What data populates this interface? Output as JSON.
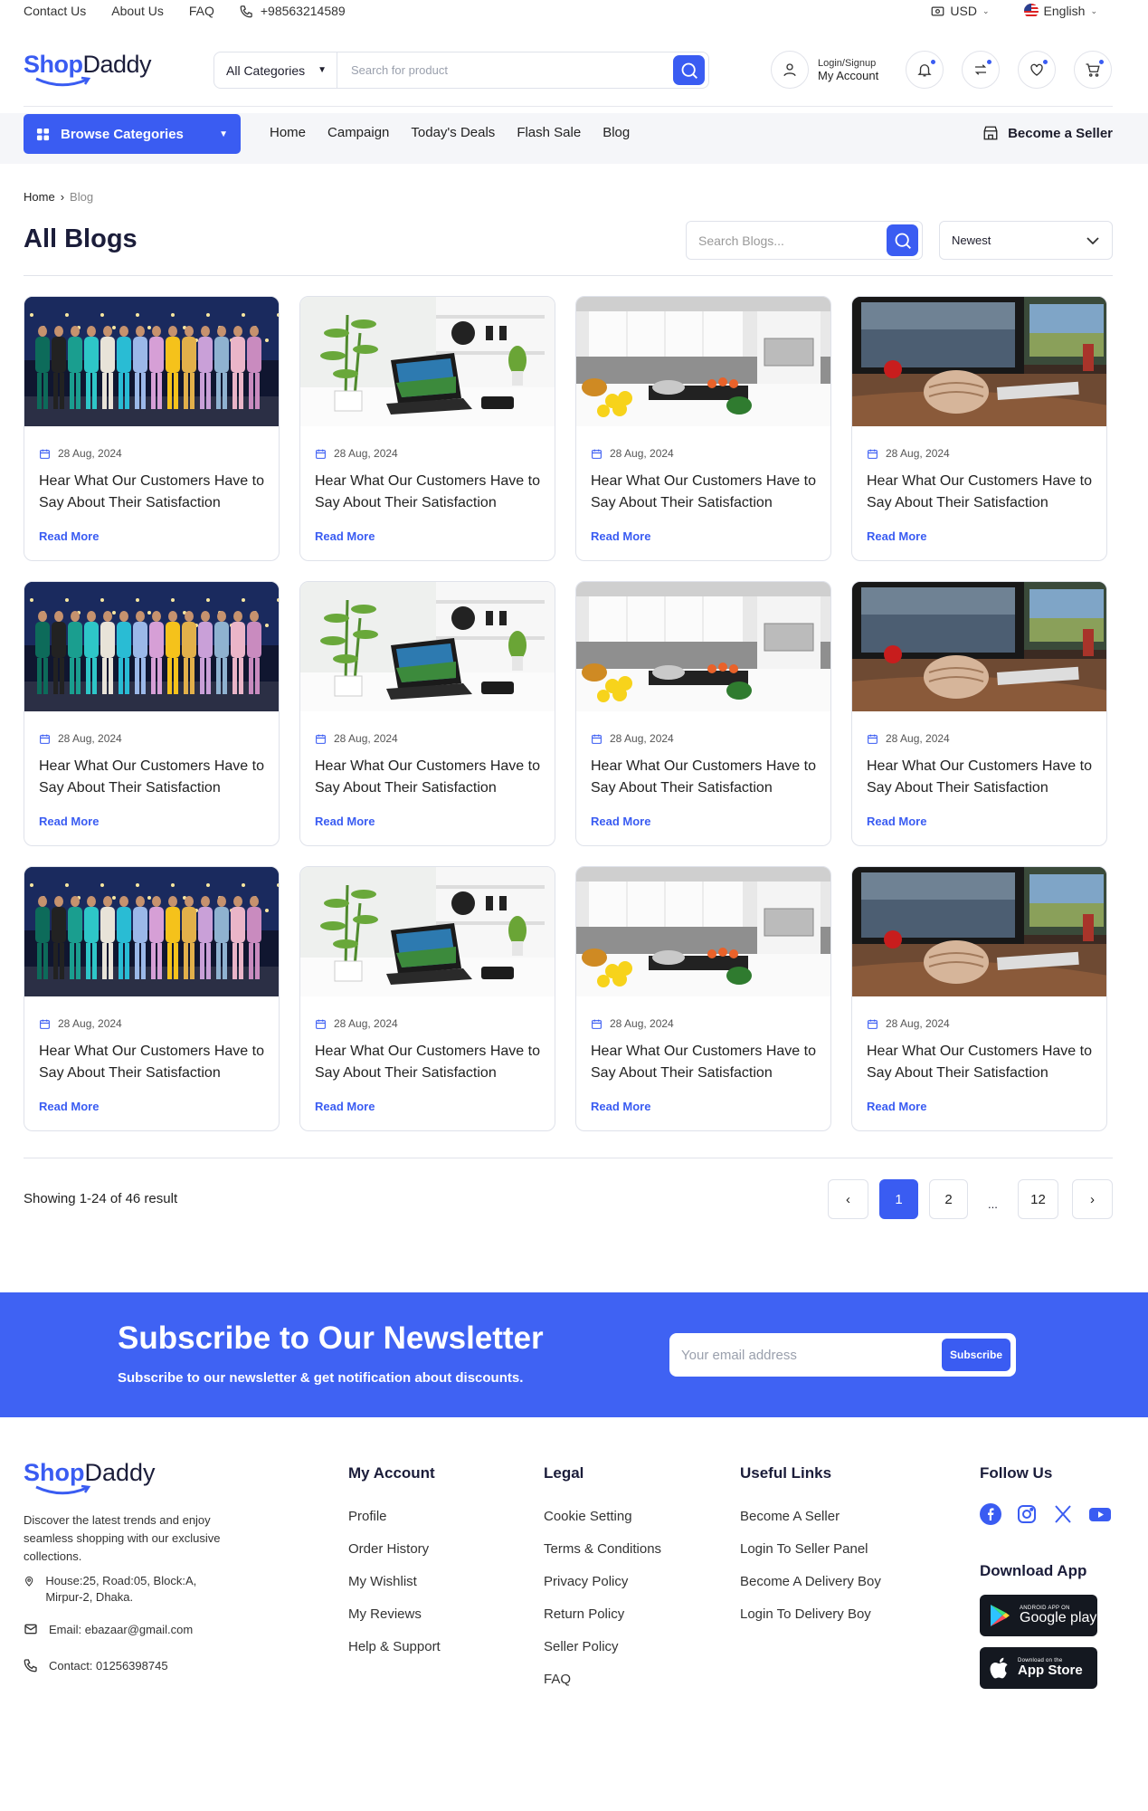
{
  "topbar": {
    "contact": "Contact Us",
    "about": "About Us",
    "faq": "FAQ",
    "phone": "+98563214589",
    "currency": "USD",
    "language": "English"
  },
  "header": {
    "logo_a": "Shop",
    "logo_b": "Daddy",
    "category": "All Categories",
    "search_placeholder": "Search for product",
    "login": "Login/Signup",
    "account": "My Account"
  },
  "nav": {
    "browse": "Browse Categories",
    "links": [
      "Home",
      "Campaign",
      "Today's Deals",
      "Flash Sale",
      "Blog"
    ],
    "seller": "Become a Seller"
  },
  "breadcrumb": {
    "home": "Home",
    "current": "Blog"
  },
  "page": {
    "title": "All Blogs",
    "search_placeholder": "Search Blogs...",
    "sort": "Newest"
  },
  "blog": {
    "date": "28 Aug, 2024",
    "title": "Hear What Our Customers Have to Say About Their Satisfaction",
    "read_more": "Read More"
  },
  "pagination": {
    "showing": "Showing 1-24 of 46 result",
    "pages": [
      "1",
      "2",
      "...",
      "12"
    ]
  },
  "newsletter": {
    "title": "Subscribe to Our Newsletter",
    "subtitle": "Subscribe to our newsletter & get notification about discounts.",
    "placeholder": "Your email address",
    "button": "Subscribe"
  },
  "footer": {
    "description": "Discover the latest trends and enjoy seamless shopping with our exclusive collections.",
    "address": "House:25, Road:05, Block:A, Mirpur-2, Dhaka.",
    "email": "Email: ebazaar@gmail.com",
    "contact": "Contact: 01256398745",
    "my_account": {
      "title": "My Account",
      "links": [
        "Profile",
        "Order History",
        "My Wishlist",
        "My Reviews",
        "Help & Support"
      ]
    },
    "legal": {
      "title": "Legal",
      "links": [
        "Cookie Setting",
        "Terms & Conditions",
        "Privacy Policy",
        "Return Policy",
        "Seller Policy",
        "FAQ"
      ]
    },
    "useful": {
      "title": "Useful Links",
      "links": [
        "Become A Seller",
        "Login To Seller Panel",
        "Become A Delivery Boy",
        "Login To Delivery Boy"
      ]
    },
    "follow": "Follow Us",
    "download": "Download App",
    "google_small": "ANDROID APP ON",
    "google_big": "Google play",
    "apple_small": "Download on the",
    "apple_big": "App Store"
  }
}
